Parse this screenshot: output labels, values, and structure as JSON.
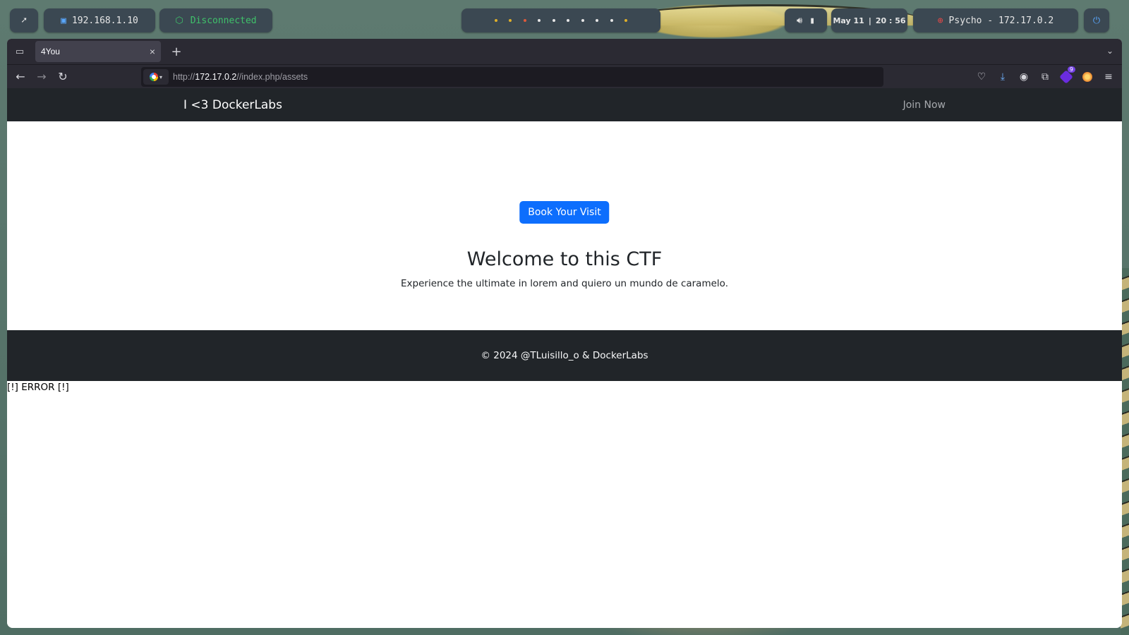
{
  "taskbar": {
    "ip_address": "192.168.1.10",
    "vpn_status": "Disconnected",
    "workspace_dot_colors": [
      "#e0b02a",
      "#e0b02a",
      "#e05a3a",
      "#e6e6e6",
      "#e6e6e6",
      "#e6e6e6",
      "#e6e6e6",
      "#e6e6e6",
      "#e6e6e6",
      "#e0b02a"
    ],
    "date": "May 11",
    "time": "20 : 56",
    "target": "Psycho - 172.17.0.2"
  },
  "browser": {
    "tab_title": "4You",
    "url_host": "172.17.0.2",
    "url_prefix": "http://",
    "url_path": "//index.php/assets",
    "extension_badge": "9"
  },
  "site": {
    "brand": "I <3 DockerLabs",
    "nav_link": "Join Now",
    "cta_button": "Book Your Visit",
    "heading": "Welcome to this CTF",
    "lead": "Experience the ultimate in lorem and quiero un mundo de caramelo.",
    "footer": "© 2024 @TLuisillo_o & DockerLabs",
    "error_output": "[!] ERROR [!]"
  },
  "colors": {
    "primary_button": "#0d6efd",
    "dark_bar": "#212529",
    "vpn_disconnected": "#3fc16a"
  }
}
